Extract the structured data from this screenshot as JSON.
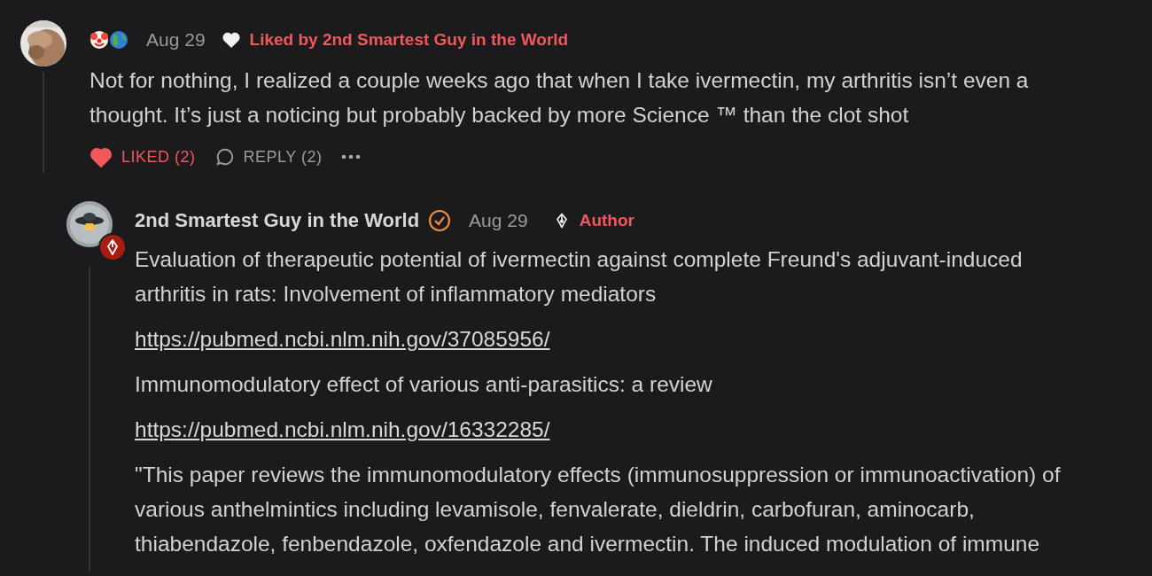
{
  "comment": {
    "date": "Aug 29",
    "liked_by": "Liked by 2nd Smartest Guy in the World",
    "body": "Not for nothing, I realized a couple weeks ago that when I take ivermectin, my arthritis isn’t even a thought. It’s just a noticing but probably backed by more Science ™ than the clot shot",
    "like": {
      "label": "LIKED (2)",
      "liked": true
    },
    "reply": {
      "label": "REPLY (2)"
    }
  },
  "reply": {
    "author": "2nd Smartest Guy in the World",
    "verified": true,
    "date": "Aug 29",
    "role": "Author",
    "paragraphs": [
      {
        "kind": "text",
        "text": "Evaluation of therapeutic potential of ivermectin against complete Freund's adjuvant-induced arthritis in rats: Involvement of inflammatory mediators"
      },
      {
        "kind": "link",
        "text": "https://pubmed.ncbi.nlm.nih.gov/37085956/"
      },
      {
        "kind": "text",
        "text": "Immunomodulatory effect of various anti-parasitics: a review"
      },
      {
        "kind": "link",
        "text": "https://pubmed.ncbi.nlm.nih.gov/16332285/"
      },
      {
        "kind": "text",
        "text": "\"This paper reviews the immunomodulatory effects (immunosuppression or immunoactivation) of various anthelmintics including levamisole, fenvalerate, dieldrin, carbofuran, aminocarb, thiabendazole, fenbendazole, oxfendazole and ivermectin. The induced modulation of immune"
      }
    ]
  }
}
